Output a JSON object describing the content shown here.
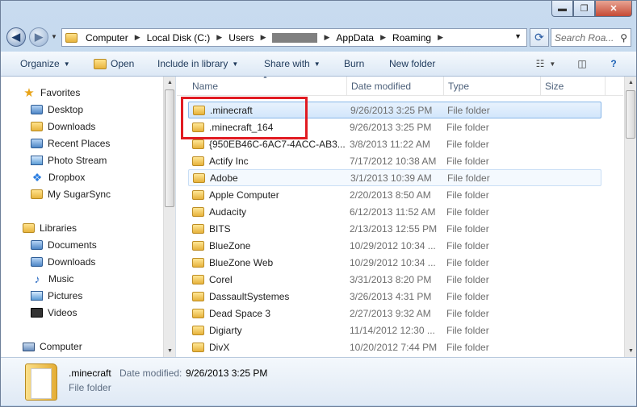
{
  "window_buttons": {
    "minimize": "▬",
    "maximize": "❐",
    "close": "✕"
  },
  "address": {
    "crumbs": [
      "Computer",
      "Local Disk (C:)",
      "Users",
      "AppData",
      "Roaming"
    ],
    "search_placeholder": "Search Roa..."
  },
  "toolbar": {
    "organize": "Organize",
    "open": "Open",
    "include_in_library": "Include in library",
    "share_with": "Share with",
    "burn": "Burn",
    "new_folder": "New folder"
  },
  "nav": {
    "favorites_label": "Favorites",
    "favorites": [
      "Desktop",
      "Downloads",
      "Recent Places",
      "Photo Stream",
      "Dropbox",
      "My SugarSync"
    ],
    "libraries_label": "Libraries",
    "libraries": [
      "Documents",
      "Downloads",
      "Music",
      "Pictures",
      "Videos"
    ],
    "computer_label": "Computer"
  },
  "columns": {
    "name": "Name",
    "date": "Date modified",
    "type": "Type",
    "size": "Size"
  },
  "files": [
    {
      "name": ".minecraft",
      "date": "9/26/2013 3:25 PM",
      "type": "File folder"
    },
    {
      "name": ".minecraft_164",
      "date": "9/26/2013 3:25 PM",
      "type": "File folder"
    },
    {
      "name": "{950EB46C-6AC7-4ACC-AB3...",
      "date": "3/8/2013 11:22 AM",
      "type": "File folder"
    },
    {
      "name": "Actify Inc",
      "date": "7/17/2012 10:38 AM",
      "type": "File folder"
    },
    {
      "name": "Adobe",
      "date": "3/1/2013 10:39 AM",
      "type": "File folder"
    },
    {
      "name": "Apple Computer",
      "date": "2/20/2013 8:50 AM",
      "type": "File folder"
    },
    {
      "name": "Audacity",
      "date": "6/12/2013 11:52 AM",
      "type": "File folder"
    },
    {
      "name": "BITS",
      "date": "2/13/2013 12:55 PM",
      "type": "File folder"
    },
    {
      "name": "BlueZone",
      "date": "10/29/2012 10:34 ...",
      "type": "File folder"
    },
    {
      "name": "BlueZone Web",
      "date": "10/29/2012 10:34 ...",
      "type": "File folder"
    },
    {
      "name": "Corel",
      "date": "3/31/2013 8:20 PM",
      "type": "File folder"
    },
    {
      "name": "DassaultSystemes",
      "date": "3/26/2013 4:31 PM",
      "type": "File folder"
    },
    {
      "name": "Dead Space 3",
      "date": "2/27/2013 9:32 AM",
      "type": "File folder"
    },
    {
      "name": "Digiarty",
      "date": "11/14/2012 12:30 ...",
      "type": "File folder"
    },
    {
      "name": "DivX",
      "date": "10/20/2012 7:44 PM",
      "type": "File folder"
    }
  ],
  "details": {
    "name": ".minecraft",
    "date_label": "Date modified:",
    "date_value": "9/26/2013 3:25 PM",
    "type": "File folder"
  }
}
